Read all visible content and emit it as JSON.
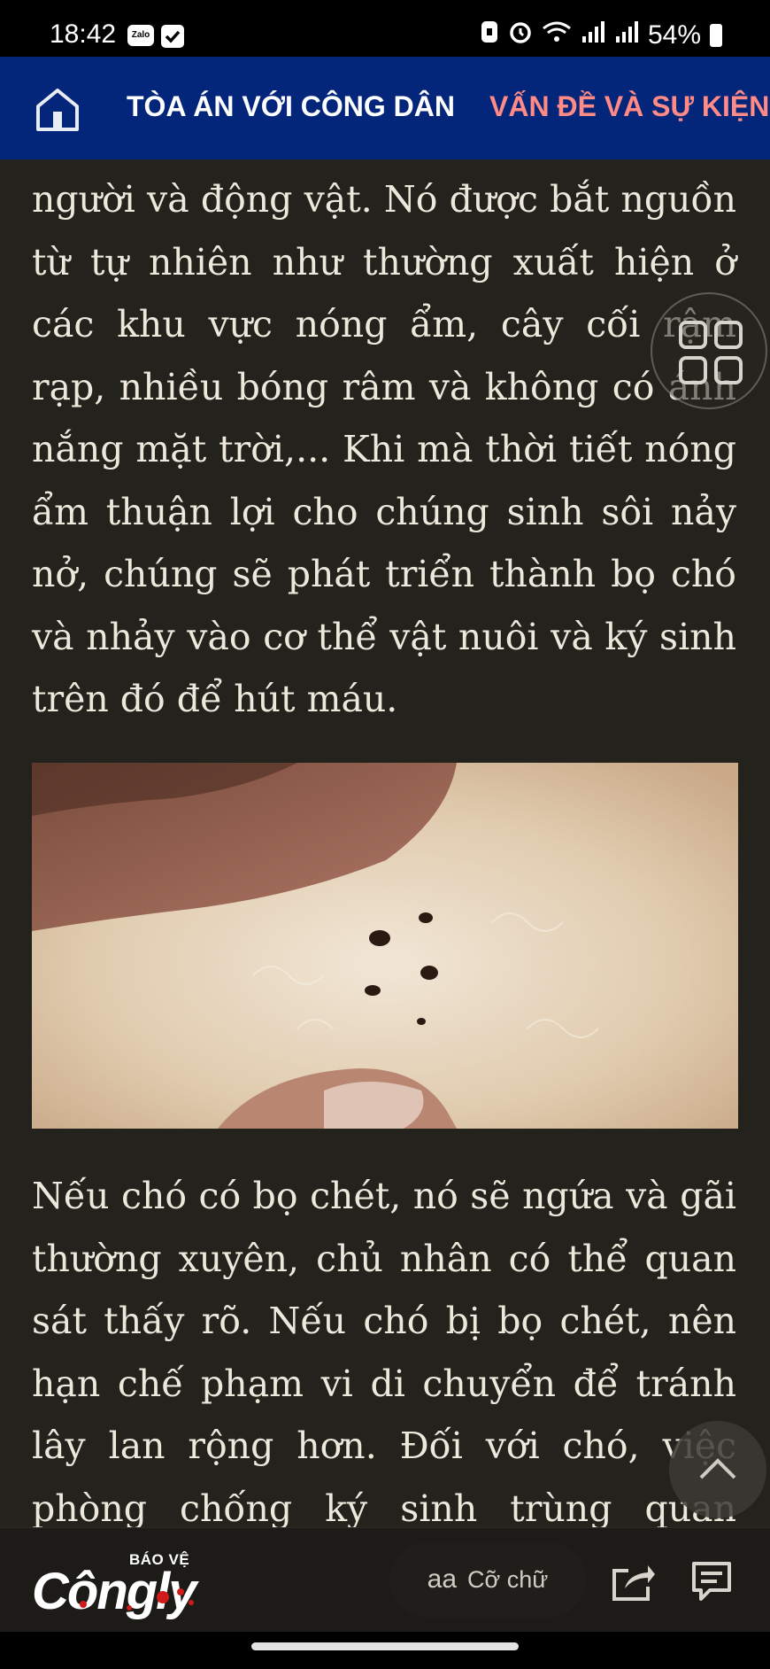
{
  "status_bar": {
    "time": "18:42",
    "zalo_label": "Zalo",
    "battery": "54%",
    "icons": [
      "zalo-icon",
      "checkbox-icon",
      "lock-icon",
      "alarm-icon",
      "wifi-icon",
      "signal-icon",
      "signal-icon",
      "battery-icon"
    ]
  },
  "nav": {
    "items": [
      {
        "label": "TÒA ÁN VỚI CÔNG DÂN"
      },
      {
        "label": "VẤN ĐỀ VÀ SỰ KIỆN"
      }
    ],
    "accent_color": "#ff8a86",
    "bar_color": "#03267a"
  },
  "article": {
    "paragraph_1": "người và động vật. Nó được bắt nguồn từ tự nhiên như thường xuất hiện ở các khu vực nóng ẩm, cây cối rậm rạp, nhiều bóng râm và không có ánh nắng mặt trời,... Khi mà thời tiết nóng ẩm thuận lợi cho chúng sinh sôi nảy nở, chúng sẽ phát triển thành bọ chó và nhảy vào cơ thể vật nuôi và ký sinh trên đó để hút máu.",
    "paragraph_2": "Nếu chó có bọ chét, nó sẽ ngứa và gãi thường xuyên, chủ nhân có thể quan sát thấy rõ. Nếu chó bị bọ chét, nên hạn chế phạm vi di chuyển để tránh lây lan rộng hơn. Đối với chó, việc phòng chống ký sinh trùng quan trọng",
    "background_color": "#24221c",
    "text_color": "#ece8dc"
  },
  "toolbar": {
    "logo_top": "BÁO VỆ",
    "logo_main": "Côngly",
    "font_icon_text": "aa",
    "font_size_label": "Cỡ chữ"
  }
}
